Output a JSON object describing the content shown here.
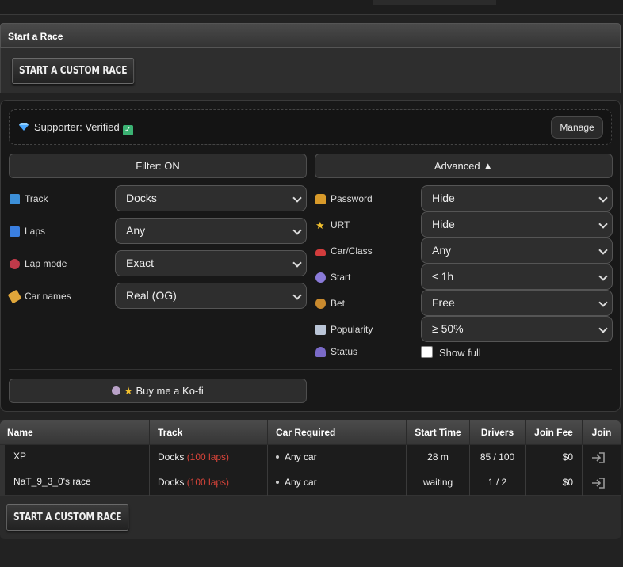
{
  "section": {
    "title": "Start a Race"
  },
  "custom_race_button": "START A CUSTOM RACE",
  "supporter": {
    "label": "Supporter: Verified",
    "manage_label": "Manage"
  },
  "filter_button": "Filter: ON",
  "advanced_button": "Advanced ▲",
  "filters_left": [
    {
      "label": "Track",
      "value": "Docks",
      "icon": "map-icon"
    },
    {
      "label": "Laps",
      "value": "Any",
      "icon": "repeat-icon"
    },
    {
      "label": "Lap mode",
      "value": "Exact",
      "icon": "target-icon"
    },
    {
      "label": "Car names",
      "value": "Real (OG)",
      "icon": "tag-icon"
    }
  ],
  "filters_right": [
    {
      "label": "Password",
      "value": "Hide",
      "icon": "lock-icon"
    },
    {
      "label": "URT",
      "value": "Hide",
      "icon": "star-icon"
    },
    {
      "label": "Car/Class",
      "value": "Any",
      "icon": "car-icon"
    },
    {
      "label": "Start",
      "value": "≤ 1h",
      "icon": "clock-icon"
    },
    {
      "label": "Bet",
      "value": "Free",
      "icon": "money-bag-icon"
    },
    {
      "label": "Popularity",
      "value": "≥ 50%",
      "icon": "chart-icon"
    }
  ],
  "status": {
    "label": "Status",
    "checkbox_label": "Show full",
    "checked": false,
    "icon": "people-icon"
  },
  "kofi_button": "Buy me a Ko-fi",
  "table": {
    "headers": [
      "Name",
      "Track",
      "Car Required",
      "Start Time",
      "Drivers",
      "Join Fee",
      "Join"
    ],
    "rows": [
      {
        "name": "XP",
        "track": "Docks",
        "laps": "(100 laps)",
        "car": "Any car",
        "start": "28 m",
        "drivers": "85 / 100",
        "fee": "$0"
      },
      {
        "name": "NaT_9_3_0's race",
        "track": "Docks",
        "laps": "(100 laps)",
        "car": "Any car",
        "start": "waiting",
        "drivers": "1 / 2",
        "fee": "$0"
      }
    ]
  },
  "colors": {
    "laps_red": "#d9443a",
    "verified_green": "#3bb273",
    "diamond_blue": "#4aa8ff"
  }
}
